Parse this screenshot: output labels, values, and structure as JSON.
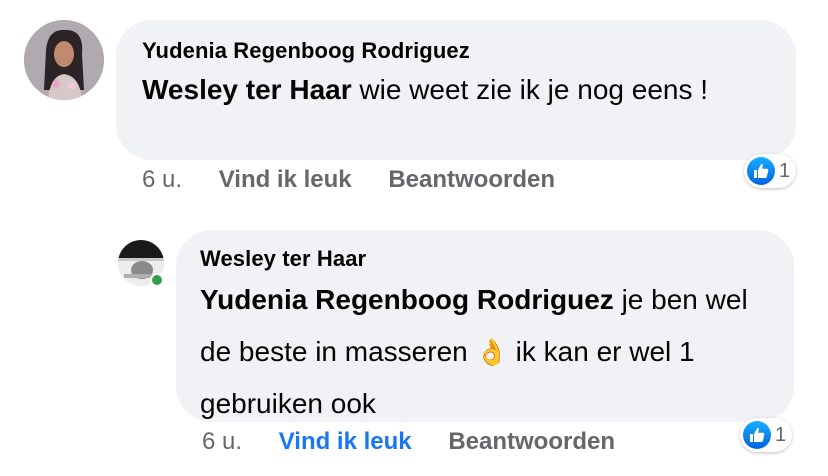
{
  "comments": [
    {
      "author": "Yudenia Regenboog Rodriguez",
      "mention": "Wesley ter Haar",
      "text": " wie weet zie ik je nog eens !",
      "time": "6 u.",
      "like_label": "Vind ik leuk",
      "reply_label": "Beantwoorden",
      "reaction_count": "1",
      "reaction_icon": "like-icon",
      "liked": false
    },
    {
      "author": "Wesley ter Haar",
      "mention": "Yudenia Regenboog Rodriguez",
      "text_before_emoji": "  je ben wel de beste in masseren ",
      "emoji": "👌",
      "text_after_emoji": " ik kan er wel 1 gebruiken ook",
      "time": "6 u.",
      "like_label": "Vind ik leuk",
      "reply_label": "Beantwoorden",
      "reaction_count": "1",
      "reaction_icon": "like-icon",
      "liked": true,
      "online": true
    }
  ],
  "colors": {
    "bubble": "#f0f2f5",
    "liked": "#1877f2",
    "action": "#65676b",
    "online": "#31a24c"
  }
}
